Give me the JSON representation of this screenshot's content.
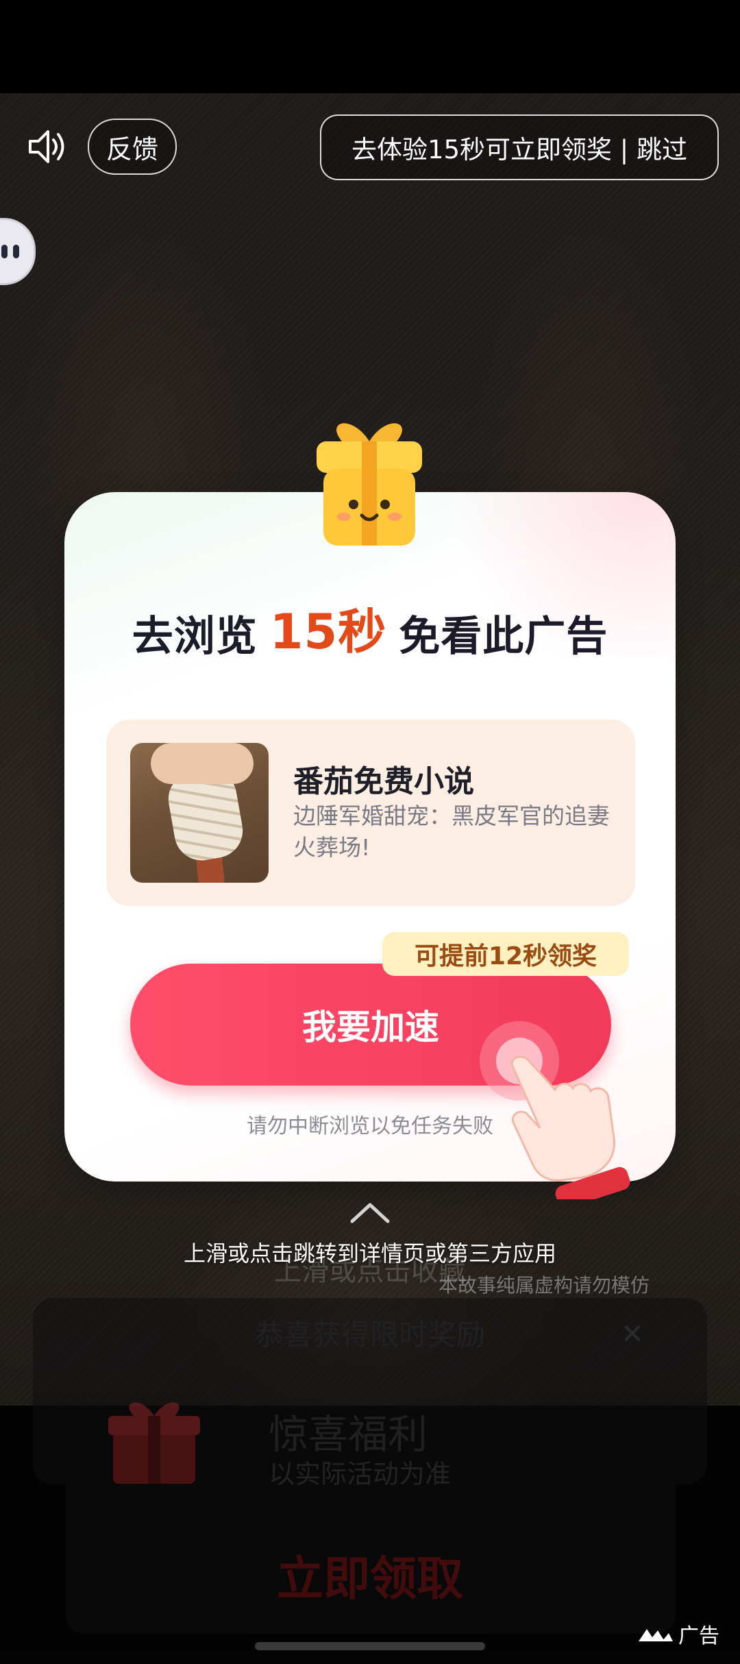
{
  "top_bar": {
    "sound_icon": "speaker-volume-icon",
    "feedback_label": "反馈",
    "skip_label": "去体验15秒可立即领奖 | 跳过"
  },
  "dialog": {
    "title_prefix": "去浏览",
    "title_highlight": "15秒",
    "title_suffix": "免看此广告",
    "app": {
      "name": "番茄免费小说",
      "description": "边陲军婚甜宠：黑皮军官的追妻火葬场!"
    },
    "early_tag": "可提前12秒领奖",
    "speed_button": "我要加速",
    "hint": "请勿中断浏览以免任务失败"
  },
  "bottom": {
    "cta": "上滑或点击跳转到详情页或第三方应用",
    "cta_ghost": "上滑或点击收藏",
    "disclaimer": "本故事纯属虚构请勿模仿",
    "reward_title": "恭喜获得限时奖励",
    "reward_name": "惊喜福利",
    "reward_sub": "以实际活动为准",
    "claim_label": "立即领取",
    "ad_label": "广告"
  },
  "colors": {
    "accent": "#f23a5a",
    "highlight": "#e24a1a",
    "tag_bg": "#fff0c2",
    "app_box_bg": "#fdeee3"
  }
}
